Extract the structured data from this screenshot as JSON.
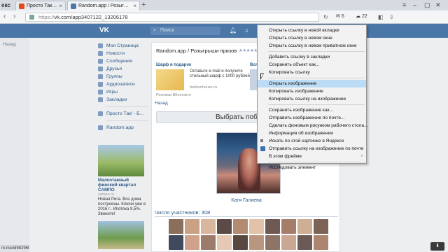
{
  "browser": {
    "logo": "екс",
    "tabs": [
      {
        "title": "Просто Так! - Бесплатно...",
        "fav_color": "#e64a19",
        "active": false
      },
      {
        "title": "Random.app / Розыгрыши...",
        "fav_color": "#4a76a8",
        "active": true
      }
    ],
    "new_tab": "+",
    "address": {
      "protocol": "https://",
      "rest": "vk.com/app3407122_13206178"
    },
    "mail_count": "6",
    "weather": "22",
    "window_controls": [
      "≡",
      "–",
      "▢",
      "✕"
    ]
  },
  "vk": {
    "search_placeholder": "Поиск",
    "back_label": "Назад",
    "menu": [
      "Моя Страница",
      "Новости",
      "Сообщения",
      "Друзья",
      "Группы",
      "Аудиозаписи",
      "Игры",
      "Закладки"
    ],
    "menu2": [
      "Просто Так! - Б...",
      "Random.app"
    ],
    "ad1": {
      "title": "Малоэтажный финский квартал САМПО",
      "src": "sampo.ru",
      "desc": "Новая Рига. Все дома построены. Ключи уже в 2016 г.. Ипотека 9,5%. Звоните!"
    }
  },
  "app": {
    "title": "Random.app / Розыгрыши призов",
    "stars": "★★★★★",
    "promo": {
      "heading": "Шарф в подарок",
      "text": "Оставьте e-mail и получите стильный шарф с 1000 рублей",
      "host": "fashionhouse.ru",
      "footer": "Реклама ВКонтакте"
    },
    "promo2_heading": "Вся",
    "back": "Назад",
    "pick_button": "Выбрать победителя",
    "winner_name": "Катя Галиева",
    "participants": "Число участников: 308"
  },
  "context_menu": {
    "group1": [
      "Открыть ссылку в новой вкладке",
      "Открыть ссылку в новом окне",
      "Открыть ссылку в новом приватном окне"
    ],
    "group2": [
      "Добавить ссылку в закладки",
      "Сохранить объект как...",
      "Копировать ссылку"
    ],
    "group3": [
      "Открыть изображение",
      "Копировать изображение",
      "Копировать ссылку на изображение"
    ],
    "group4": [
      "Сохранить изображение как...",
      "Отправить изображение по почте...",
      "Сделать фоновым рисунком рабочего стола...",
      "Информация об изображении",
      "Искать по этой картинке в Яндексе",
      "Отправить ссылку на изображение по почте",
      "В этом фрейме"
    ],
    "group5": [
      "Исследовать элемент"
    ],
    "highlighted": "Открыть изображение"
  },
  "status_bar": "m.me/id9829607",
  "downloads_label": "⬇"
}
